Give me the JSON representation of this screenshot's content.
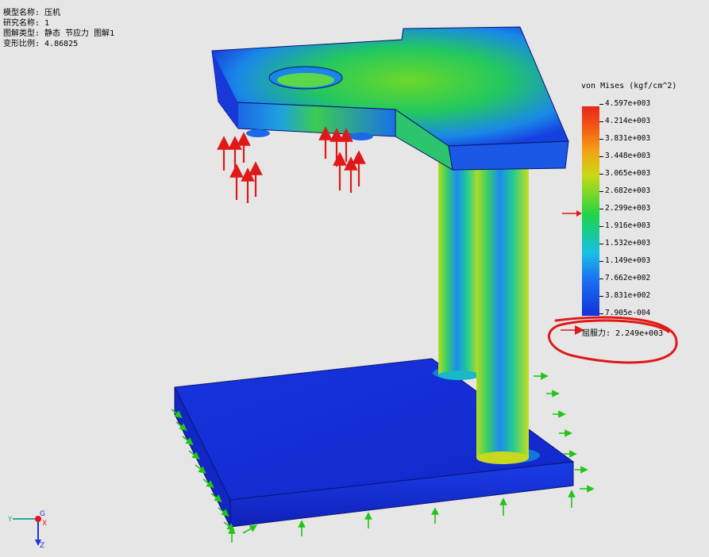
{
  "info": {
    "model_name": "模型名称: 压机",
    "study_name": "研究名称: 1",
    "plot_type": "图解类型: 静态 节应力 图解1",
    "deformation_scale": "变形比例: 4.86825"
  },
  "legend": {
    "title": "von Mises (kgf/cm^2)",
    "ticks": [
      "4.597e+003",
      "4.214e+003",
      "3.831e+003",
      "3.448e+003",
      "3.065e+003",
      "2.682e+003",
      "2.299e+003",
      "1.916e+003",
      "1.532e+003",
      "1.149e+003",
      "7.662e+002",
      "3.831e+002",
      "7.905e-004"
    ],
    "yield_label": "屈服力: 2.249e+003"
  },
  "triad": {
    "y_label": "Y",
    "g_label": "G",
    "x_label": "X",
    "z_label": "Z"
  },
  "colors": {
    "accent_red": "#e01818",
    "fixture_green": "#22c418",
    "plate_blue": "#1530dc"
  }
}
